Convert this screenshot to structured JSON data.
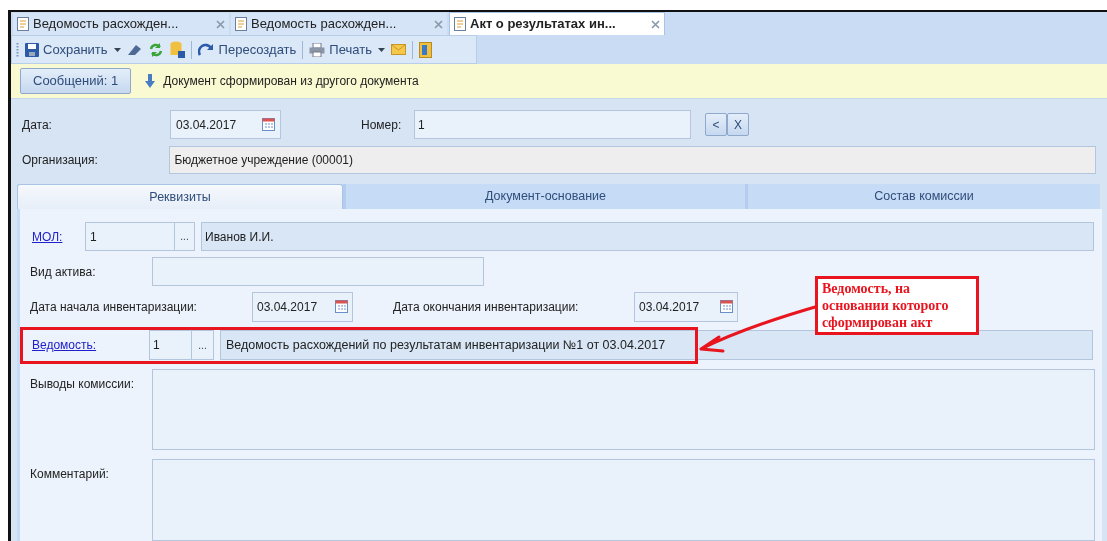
{
  "doc_tabs": [
    {
      "label": "Ведомость расхожден...",
      "selected": false
    },
    {
      "label": "Ведомость расхожден...",
      "selected": false
    },
    {
      "label": "Акт о результатах ин...",
      "selected": true
    }
  ],
  "toolbar": {
    "save": "Сохранить",
    "recreate": "Пересоздать",
    "print": "Печать"
  },
  "messages": {
    "button": "Сообщений: 1",
    "text": "Документ сформирован из другого документа"
  },
  "header": {
    "date_label": "Дата:",
    "date": "03.04.2017",
    "number_label": "Номер:",
    "number": "1",
    "nav_buttons": [
      "<",
      "X"
    ],
    "org_label": "Организация:",
    "org": "Бюджетное учреждение (00001)"
  },
  "form_tabs": [
    {
      "label": "Реквизиты",
      "selected": true
    },
    {
      "label": "Документ-основание",
      "selected": false
    },
    {
      "label": "Состав комиссии",
      "selected": false
    }
  ],
  "mol": {
    "label": "МОЛ:",
    "code": "1",
    "button": "...",
    "name": "Иванов И.И."
  },
  "asset_type": {
    "label": "Вид актива:"
  },
  "start": {
    "label": "Дата начала инвентаризации:",
    "date": "03.04.2017"
  },
  "end": {
    "label": "Дата окончания инвентаризации:",
    "date": "03.04.2017"
  },
  "statement": {
    "label": "Ведомость:",
    "code": "1",
    "button": "...",
    "name": "Ведомость расхождений по результатам инвентаризации №1 от 03.04.2017"
  },
  "conclusions": {
    "label": "Выводы комиссии:"
  },
  "comment": {
    "label": "Комментарий:"
  },
  "annotation": {
    "lines": [
      "Ведомость, на",
      "основании которого",
      "сформирован акт"
    ]
  }
}
